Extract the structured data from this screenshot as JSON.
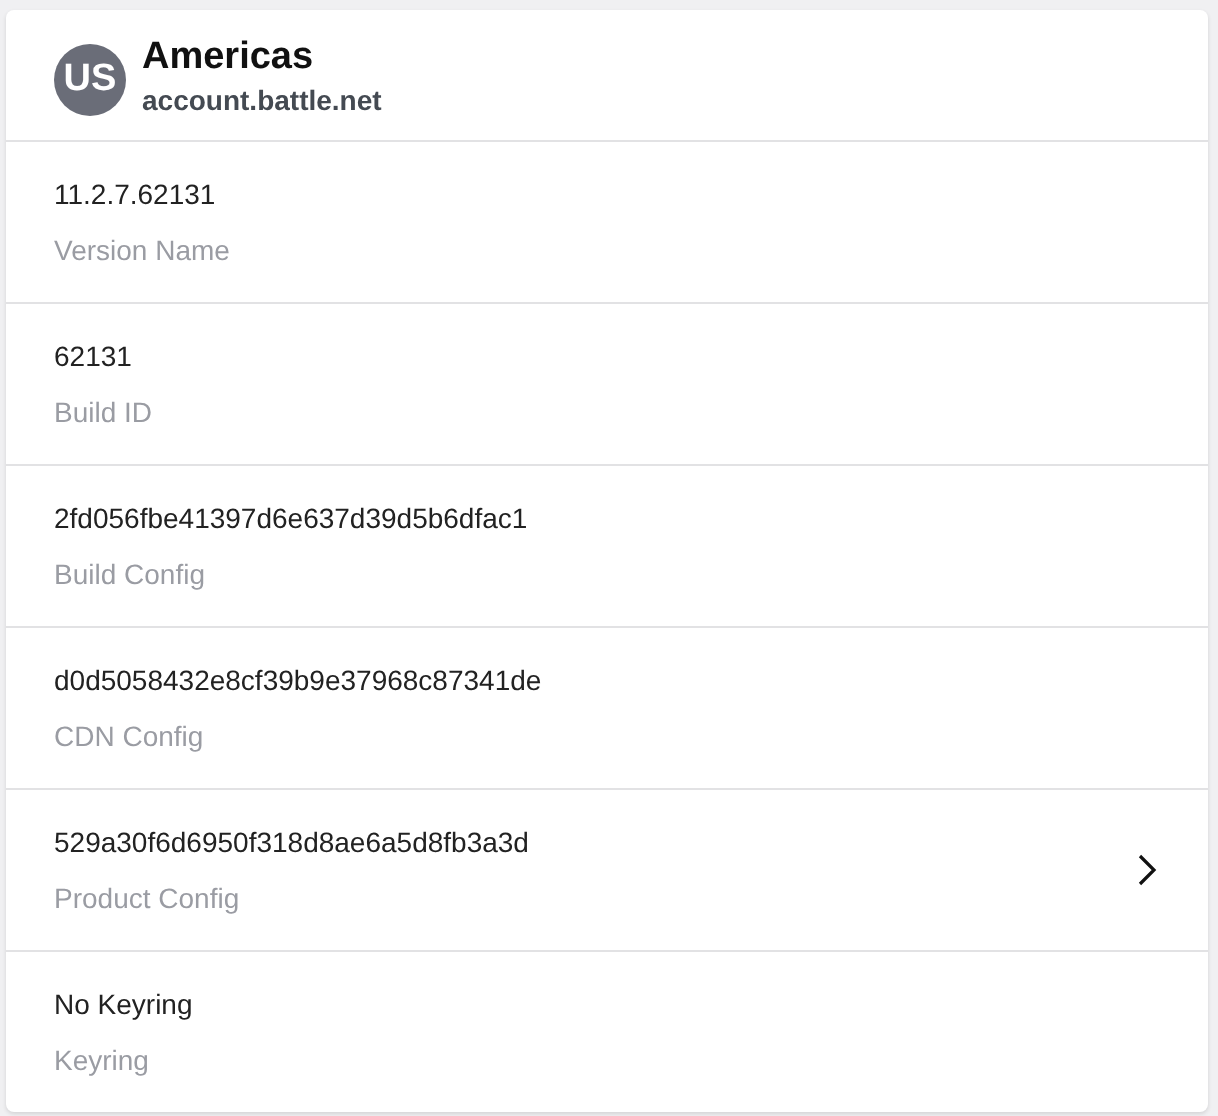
{
  "header": {
    "avatar": "US",
    "title": "Americas",
    "subtitle": "account.battle.net"
  },
  "rows": [
    {
      "value": "11.2.7.62131",
      "label": "Version Name",
      "link": false
    },
    {
      "value": "62131",
      "label": "Build ID",
      "link": false
    },
    {
      "value": "2fd056fbe41397d6e637d39d5b6dfac1",
      "label": "Build Config",
      "link": false
    },
    {
      "value": "d0d5058432e8cf39b9e37968c87341de",
      "label": "CDN Config",
      "link": false
    },
    {
      "value": "529a30f6d6950f318d8ae6a5d8fb3a3d",
      "label": "Product Config",
      "link": true
    },
    {
      "value": "No Keyring",
      "label": "Keyring",
      "link": false
    }
  ]
}
